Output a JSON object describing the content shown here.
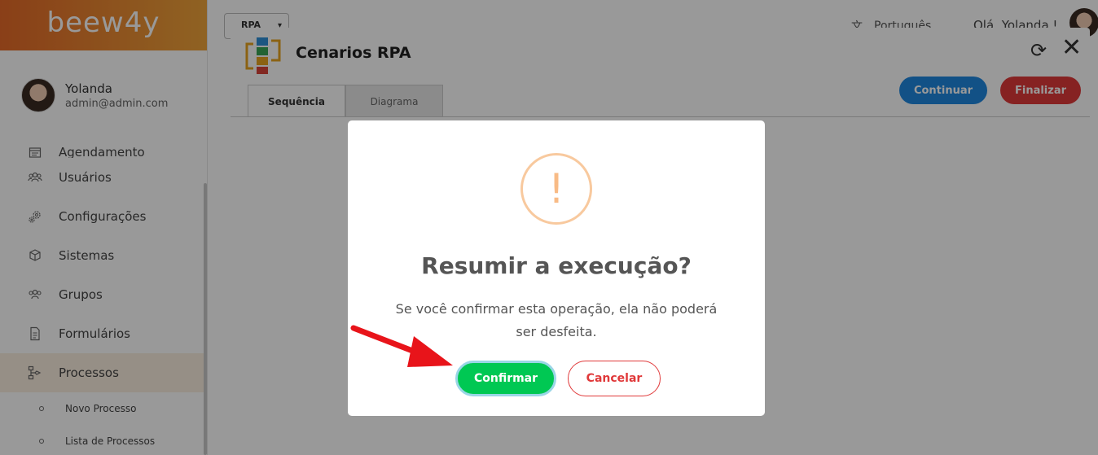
{
  "sidebar": {
    "logo": "beew4y",
    "user": {
      "name": "Yolanda",
      "email": "admin@admin.com"
    },
    "items": [
      {
        "label": "Agendamento",
        "icon": "calendar-icon"
      },
      {
        "label": "Usuários",
        "icon": "users-icon"
      },
      {
        "label": "Configurações",
        "icon": "gears-icon"
      },
      {
        "label": "Sistemas",
        "icon": "cube-icon"
      },
      {
        "label": "Grupos",
        "icon": "group-icon"
      },
      {
        "label": "Formulários",
        "icon": "document-icon"
      },
      {
        "label": "Processos",
        "icon": "flow-icon",
        "active": true
      }
    ],
    "subitems": [
      {
        "label": "Novo Processo"
      },
      {
        "label": "Lista de Processos"
      }
    ]
  },
  "topbar": {
    "module_select": "RPA",
    "language": "Português",
    "greeting": "Olá, Yolanda !"
  },
  "panel": {
    "title": "Cenarios RPA",
    "tabs": [
      {
        "label": "Sequência",
        "active": true
      },
      {
        "label": "Diagrama",
        "active": false
      }
    ],
    "continue_label": "Continuar",
    "finish_label": "Finalizar"
  },
  "dialog": {
    "icon": "!",
    "title": "Resumir a execução?",
    "text": "Se você confirmar esta operação, ela não poderá ser desfeita.",
    "confirm_label": "Confirmar",
    "cancel_label": "Cancelar"
  },
  "colors": {
    "brand_orange": "#e66a28",
    "continue_blue": "#1f87e0",
    "finish_red": "#e0393a",
    "confirm_green": "#00c853",
    "warning_orange": "#f8bb86",
    "arrow_red": "#e8141a"
  }
}
